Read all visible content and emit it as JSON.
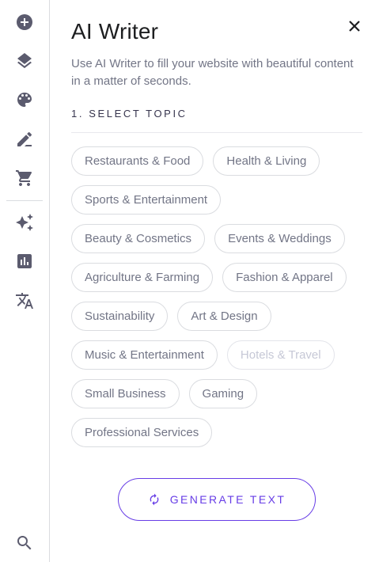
{
  "sidebar": {
    "items": [
      {
        "name": "add-icon"
      },
      {
        "name": "layers-icon"
      },
      {
        "name": "palette-icon"
      },
      {
        "name": "edit-icon"
      },
      {
        "name": "cart-icon"
      },
      {
        "name": "sparkles-icon"
      },
      {
        "name": "analytics-icon"
      },
      {
        "name": "translate-icon"
      },
      {
        "name": "search-icon"
      }
    ]
  },
  "panel": {
    "title": "AI Writer",
    "description": "Use AI Writer to fill your website with beautiful content in a matter of seconds.",
    "step_label": "1. SELECT TOPIC",
    "close_icon": "close-icon",
    "topics": [
      {
        "label": "Restaurants & Food",
        "disabled": false
      },
      {
        "label": "Health & Living",
        "disabled": false
      },
      {
        "label": "Sports & Entertainment",
        "disabled": false
      },
      {
        "label": "Beauty & Cosmetics",
        "disabled": false
      },
      {
        "label": "Events & Weddings",
        "disabled": false
      },
      {
        "label": "Agriculture & Farming",
        "disabled": false
      },
      {
        "label": "Fashion & Apparel",
        "disabled": false
      },
      {
        "label": "Sustainability",
        "disabled": false
      },
      {
        "label": "Art & Design",
        "disabled": false
      },
      {
        "label": "Music & Entertainment",
        "disabled": false
      },
      {
        "label": "Hotels & Travel",
        "disabled": true
      },
      {
        "label": "Small Business",
        "disabled": false
      },
      {
        "label": "Gaming",
        "disabled": false
      },
      {
        "label": "Professional Services",
        "disabled": false
      }
    ],
    "generate_label": "GENERATE TEXT",
    "generate_icon": "refresh-icon"
  },
  "colors": {
    "accent": "#673de6",
    "text_dark": "#1d1e20",
    "text_muted": "#727586",
    "icon_gray": "#5b5b6e",
    "border": "#dadce0",
    "disabled_text": "#c6c8d6"
  }
}
